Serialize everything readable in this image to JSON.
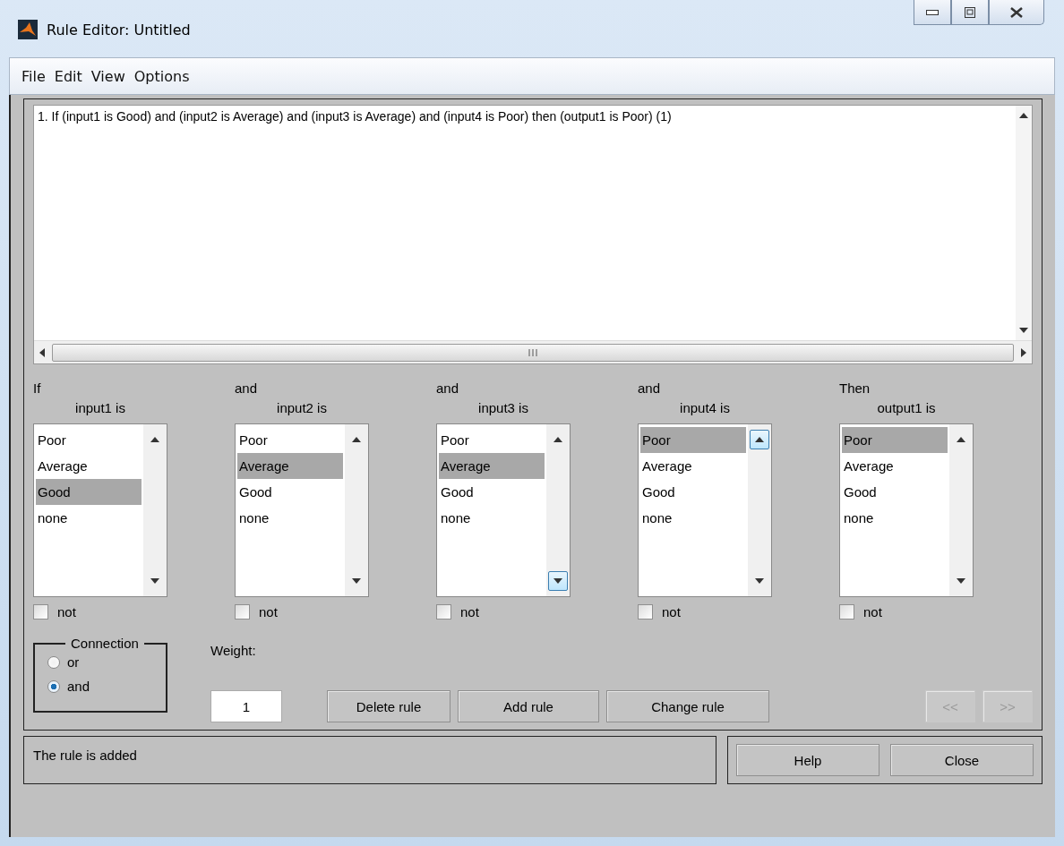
{
  "window": {
    "title": "Rule Editor: Untitled"
  },
  "menu": [
    {
      "label": "File"
    },
    {
      "label": "Edit"
    },
    {
      "label": "View"
    },
    {
      "label": "Options"
    }
  ],
  "rules": [
    {
      "text": "1. If (input1 is Good) and (input2 is Average) and (input3 is Average) and (input4 is Poor) then (output1 is Poor) (1)",
      "selected": false
    }
  ],
  "columns": [
    {
      "connector": "If",
      "label": "input1 is",
      "items": [
        {
          "label": "Poor",
          "selected": false
        },
        {
          "label": "Average",
          "selected": false
        },
        {
          "label": "Good",
          "selected": true
        },
        {
          "label": "none",
          "selected": false
        }
      ],
      "not": {
        "label": "not",
        "checked": false
      }
    },
    {
      "connector": "and",
      "label": "input2 is",
      "items": [
        {
          "label": "Poor",
          "selected": false
        },
        {
          "label": "Average",
          "selected": true
        },
        {
          "label": "Good",
          "selected": false
        },
        {
          "label": "none",
          "selected": false
        }
      ],
      "not": {
        "label": "not",
        "checked": false
      }
    },
    {
      "connector": "and",
      "label": "input3 is",
      "items": [
        {
          "label": "Poor",
          "selected": false
        },
        {
          "label": "Average",
          "selected": true
        },
        {
          "label": "Good",
          "selected": false
        },
        {
          "label": "none",
          "selected": false
        }
      ],
      "not": {
        "label": "not",
        "checked": false
      }
    },
    {
      "connector": "and",
      "label": "input4 is",
      "items": [
        {
          "label": "Poor",
          "selected": true
        },
        {
          "label": "Average",
          "selected": false
        },
        {
          "label": "Good",
          "selected": false
        },
        {
          "label": "none",
          "selected": false
        }
      ],
      "not": {
        "label": "not",
        "checked": false
      }
    },
    {
      "connector": "Then",
      "label": "output1 is",
      "items": [
        {
          "label": "Poor",
          "selected": true
        },
        {
          "label": "Average",
          "selected": false
        },
        {
          "label": "Good",
          "selected": false
        },
        {
          "label": "none",
          "selected": false
        }
      ],
      "not": {
        "label": "not",
        "checked": false
      }
    }
  ],
  "connection": {
    "title": "Connection",
    "options": [
      {
        "label": "or",
        "selected": false
      },
      {
        "label": "and",
        "selected": true
      }
    ]
  },
  "weight": {
    "label": "Weight:",
    "value": "1"
  },
  "buttons": [
    {
      "label": "Delete rule",
      "disabled": false
    },
    {
      "label": "Add rule",
      "disabled": false
    },
    {
      "label": "Change rule",
      "disabled": false
    }
  ],
  "nav_buttons": [
    {
      "label": "<<",
      "disabled": true
    },
    {
      "label": ">>",
      "disabled": true
    }
  ],
  "status": "The rule is added",
  "footer_buttons": [
    {
      "label": "Help"
    },
    {
      "label": "Close"
    }
  ]
}
